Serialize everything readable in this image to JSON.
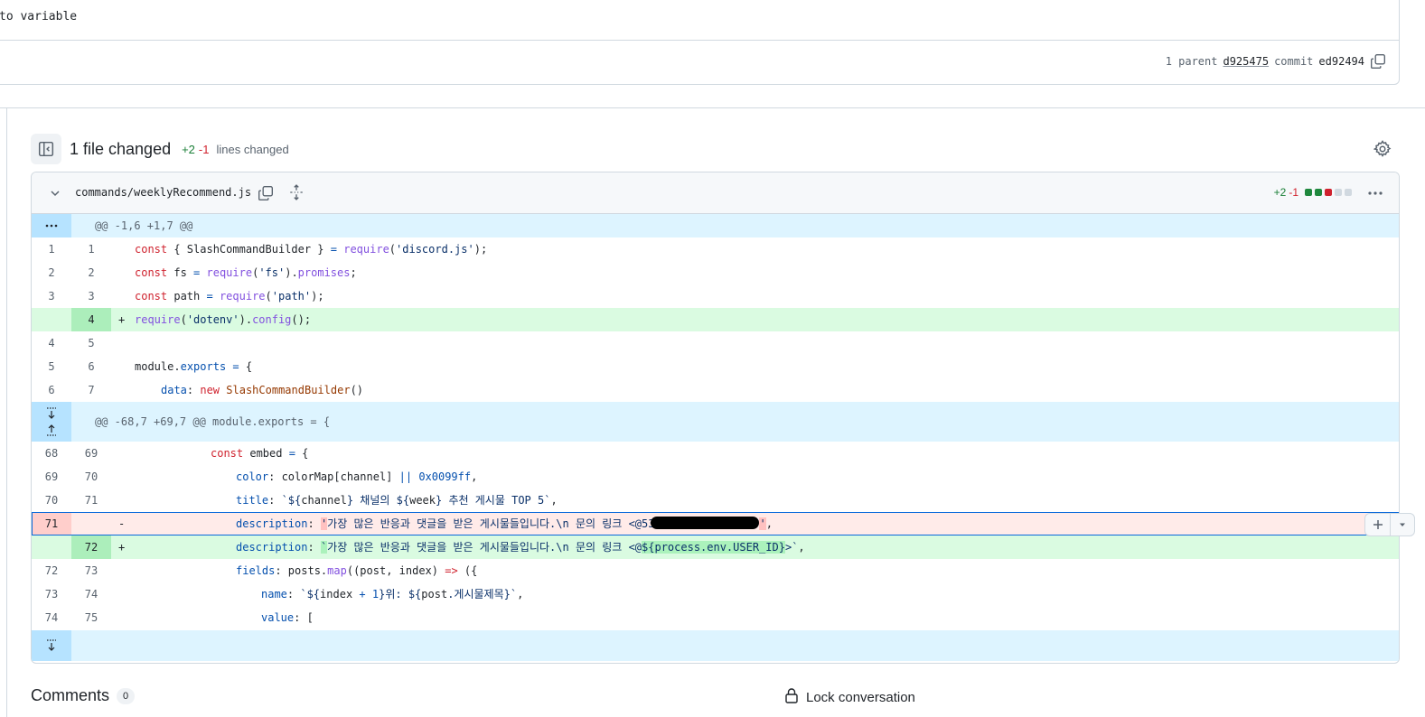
{
  "commit": {
    "message": "to variable",
    "parent_label": "1 parent",
    "parent_sha": "d925475",
    "commit_label": "commit",
    "commit_sha": "ed92494"
  },
  "files_changed": {
    "title": "1 file changed",
    "additions": "+2",
    "deletions": "-1",
    "lines_label": "lines changed"
  },
  "file": {
    "name": "commands/weeklyRecommend.js",
    "additions": "+2",
    "deletions": "-1"
  },
  "hunks": [
    {
      "header": "@@ -1,6 +1,7 @@"
    },
    {
      "header": "@@ -68,7 +69,7 @@ module.exports = {"
    }
  ],
  "lines": {
    "r1": {
      "old": "1",
      "new": "1"
    },
    "r2": {
      "old": "2",
      "new": "2"
    },
    "r3": {
      "old": "3",
      "new": "3"
    },
    "r4": {
      "old": "",
      "new": "4",
      "sign": "+"
    },
    "r5": {
      "old": "4",
      "new": "5"
    },
    "r6": {
      "old": "5",
      "new": "6"
    },
    "r7": {
      "old": "6",
      "new": "7"
    },
    "r8": {
      "old": "68",
      "new": "69"
    },
    "r9": {
      "old": "69",
      "new": "70"
    },
    "r10": {
      "old": "70",
      "new": "71"
    },
    "r11": {
      "old": "71",
      "new": "",
      "sign": "-"
    },
    "r12": {
      "old": "",
      "new": "72",
      "sign": "+"
    },
    "r13": {
      "old": "72",
      "new": "73"
    },
    "r14": {
      "old": "73",
      "new": "74"
    },
    "r15": {
      "old": "74",
      "new": "75"
    }
  },
  "code": {
    "r1": {
      "t1": "const",
      "t2": " { SlashCommandBuilder } ",
      "t3": "=",
      "t4": " ",
      "t5": "require",
      "t6": "(",
      "t7": "'discord.js'",
      "t8": ");"
    },
    "r2": {
      "t1": "const",
      "t2": " fs ",
      "t3": "=",
      "t4": " ",
      "t5": "require",
      "t6": "(",
      "t7": "'fs'",
      "t8": ").",
      "t9": "promises",
      "t10": ";"
    },
    "r3": {
      "t1": "const",
      "t2": " path ",
      "t3": "=",
      "t4": " ",
      "t5": "require",
      "t6": "(",
      "t7": "'path'",
      "t8": ");"
    },
    "r4": {
      "t1": "require",
      "t2": "(",
      "t3": "'dotenv'",
      "t4": ").",
      "t5": "config",
      "t6": "();"
    },
    "r6": {
      "t1": "module",
      "t2": ".",
      "t3": "exports",
      "t4": " ",
      "t5": "=",
      "t6": " {"
    },
    "r7": {
      "t1": "data",
      "t2": ": ",
      "t3": "new",
      "t4": " ",
      "t5": "SlashCommandBuilder",
      "t6": "()"
    },
    "r8": {
      "t1": "const",
      "t2": " embed ",
      "t3": "=",
      "t4": " {"
    },
    "r9": {
      "t1": "color",
      "t2": ": colorMap[channel] ",
      "t3": "||",
      "t4": " ",
      "t5": "0x0099ff",
      "t6": ","
    },
    "r10": {
      "t1": "title",
      "t2": ": ",
      "t3": "`${",
      "t4": "channel",
      "t5": "} 채널의 ${",
      "t6": "week",
      "t7": "} 추천 게시물 TOP 5`",
      "t8": ","
    },
    "r11": {
      "t1": "description",
      "t2": ": ",
      "t3": "'",
      "t4": "가장 많은 반응과 댓글을 받은 게시물들입니다.\\n 문의 링크 <@53",
      "t5": "'",
      "t6": ","
    },
    "r12": {
      "t1": "description",
      "t2": ": ",
      "t3": "`",
      "t4": "가장 많은 반응과 댓글을 받은 게시물들입니다.\\n 문의 링크 <@",
      "t5": "${process.env.USER_ID}",
      "t6": ">`",
      "t7": ","
    },
    "r13": {
      "t1": "fields",
      "t2": ": posts.",
      "t3": "map",
      "t4": "((post, index) ",
      "t5": "=>",
      "t6": " ({"
    },
    "r14": {
      "t1": "name",
      "t2": ": ",
      "t3": "`${",
      "t4": "index ",
      "t5": "+",
      "t6": " ",
      "t7": "1",
      "t8": "}위: ${",
      "t9": "post",
      "t10": ".게시물제목}`",
      "t11": ","
    },
    "r15": {
      "t1": "value",
      "t2": ": ["
    }
  },
  "comments": {
    "title": "Comments",
    "count": "0"
  },
  "lock": {
    "label": "Lock conversation"
  },
  "icons": {
    "copy": "copy-icon",
    "gear": "gear-icon",
    "chevron": "chevron-down-icon",
    "expand": "move-icon",
    "kebab": "kebab-horizontal-icon",
    "lock": "lock-icon",
    "sidebar": "sidebar-collapse-icon",
    "plus": "plus-icon"
  },
  "colors": {
    "addition": "#1a7f37",
    "deletion": "#d1242f",
    "add_bg": "#dafbe1",
    "del_bg": "#ffebe9",
    "hunk_bg": "#ddf4ff",
    "focus": "#0969da"
  }
}
